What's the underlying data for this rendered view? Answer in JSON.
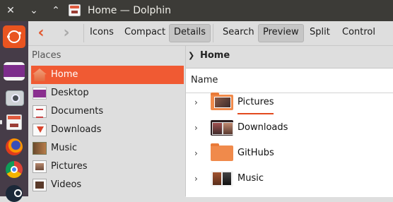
{
  "window": {
    "title": "Home — Dolphin"
  },
  "titlebar_controls": {
    "close": "✕",
    "minimize": "⌄",
    "maximize": "⌃"
  },
  "toolbar": {
    "back_glyph": "‹",
    "forward_glyph": "›",
    "buttons": [
      {
        "label": "Icons",
        "active": false
      },
      {
        "label": "Compact",
        "active": false
      },
      {
        "label": "Details",
        "active": true
      },
      {
        "label": "Search",
        "active": false
      },
      {
        "label": "Preview",
        "active": true
      },
      {
        "label": "Split",
        "active": false
      },
      {
        "label": "Control",
        "active": false
      }
    ]
  },
  "places": {
    "heading": "Places",
    "items": [
      {
        "label": "Home",
        "icon": "home-icon",
        "selected": true
      },
      {
        "label": "Desktop",
        "icon": "desktop-icon",
        "selected": false
      },
      {
        "label": "Documents",
        "icon": "documents-icon",
        "selected": false
      },
      {
        "label": "Downloads",
        "icon": "downloads-icon",
        "selected": false
      },
      {
        "label": "Music",
        "icon": "music-icon",
        "selected": false
      },
      {
        "label": "Pictures",
        "icon": "pictures-icon",
        "selected": false
      },
      {
        "label": "Videos",
        "icon": "videos-icon",
        "selected": false
      }
    ]
  },
  "breadcrumb": {
    "separator": "❯",
    "location": "Home"
  },
  "file_view": {
    "column_name": "Name",
    "expander_glyph": "›",
    "rows": [
      {
        "name": "Pictures",
        "icon": "pictures-folder-icon"
      },
      {
        "name": "Downloads",
        "icon": "downloads-folder-icon"
      },
      {
        "name": "GitHubs",
        "icon": "folder-icon"
      },
      {
        "name": "Music",
        "icon": "music-folder-icon"
      }
    ]
  },
  "launcher": {
    "items": [
      {
        "icon": "ubuntu-logo-icon"
      },
      {
        "icon": "workspace-switcher-icon"
      },
      {
        "icon": "screenshot-camera-icon"
      },
      {
        "icon": "dolphin-icon"
      },
      {
        "icon": "firefox-icon"
      },
      {
        "icon": "chrome-icon"
      },
      {
        "icon": "steam-icon"
      }
    ]
  },
  "colors": {
    "accent": "#f05a33",
    "titlebar": "#3c3b37",
    "launcher": "#463c48",
    "folder": "#f08a4b"
  }
}
